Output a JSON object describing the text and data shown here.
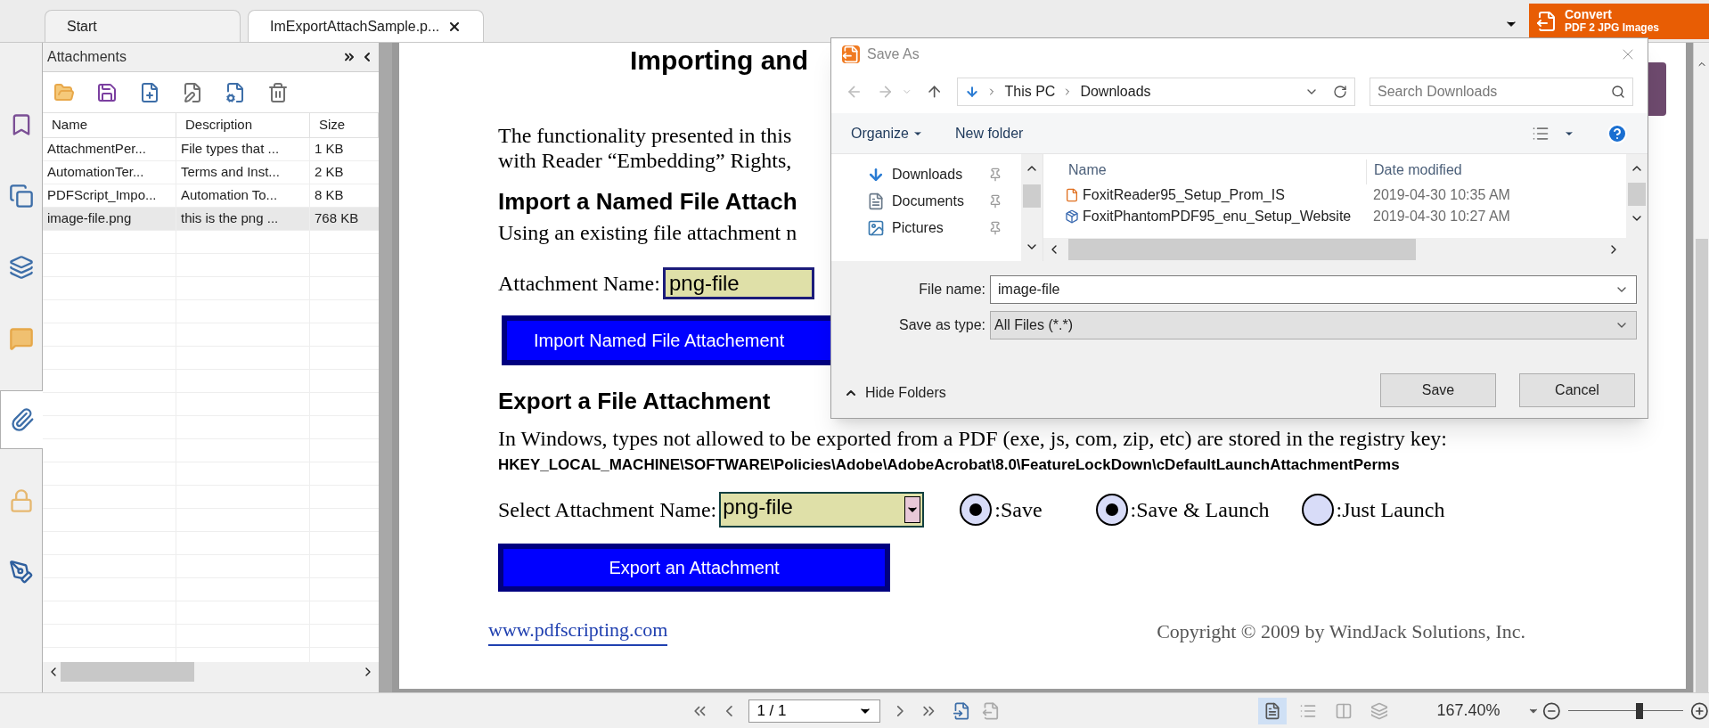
{
  "tabs": [
    {
      "label": "Start",
      "selected": false
    },
    {
      "label": "ImExportAttachSample.p...",
      "selected": true
    }
  ],
  "convert_banner": {
    "line_1": "Convert",
    "line_2": "PDF 2 JPG Images"
  },
  "left_tabs": [
    {
      "kind": "bookmarks",
      "selected": false
    },
    {
      "kind": "pages",
      "selected": false
    },
    {
      "kind": "layers",
      "selected": false
    },
    {
      "kind": "comments",
      "selected": false
    },
    {
      "kind": "attachments",
      "selected": true
    },
    {
      "kind": "security",
      "selected": false
    },
    {
      "kind": "signatures",
      "selected": false
    }
  ],
  "attachments_panel": {
    "title": "Attachments",
    "columns": [
      "Name",
      "Description",
      "Size"
    ],
    "rows": [
      {
        "name": "AttachmentPer...",
        "description": "File types that ...",
        "size": "1 KB",
        "selected": false
      },
      {
        "name": "AutomationTer...",
        "description": "Terms and Inst...",
        "size": "2 KB",
        "selected": false
      },
      {
        "name": "PDFScript_Impo...",
        "description": "Automation To...",
        "size": "8 KB",
        "selected": false
      },
      {
        "name": "image-file.png",
        "description": "this is the png ...",
        "size": "768 KB",
        "selected": true
      }
    ]
  },
  "document": {
    "title": "Importing and",
    "intro_lines": [
      "The functionality presented in this",
      "with Reader “Embedding” Rights,"
    ],
    "import_heading": "Import a Named File Attach",
    "import_text": "Using an existing file attachment n",
    "attachment_label": "Attachment Name:",
    "attachment_value": "png-file",
    "import_button": "Import Named File Attachement",
    "export_heading": "Export a File Attachment",
    "export_text": "In Windows, types not allowed to be exported from a PDF (exe, js, com, zip, etc) are stored in the registry key:",
    "registry_key": "HKEY_LOCAL_MACHINE\\SOFTWARE\\Policies\\Adobe\\AdobeAcrobat\\8.0\\FeatureLockDown\\cDefaultLaunchAttachmentPerms",
    "select_label": "Select Attachment Name:",
    "select_value": "png-file",
    "options": [
      {
        "label": ":Save",
        "checked": true
      },
      {
        "label": ":Save & Launch",
        "checked": true
      },
      {
        "label": ":Just Launch",
        "checked": false
      }
    ],
    "export_button": "Export an Attachment",
    "link": "www.pdfscripting.com",
    "copyright": "Copyright © 2009 by WindJack Solutions, Inc."
  },
  "save_dialog": {
    "title": "Save As",
    "breadcrumb": [
      "This PC",
      "Downloads"
    ],
    "search": {
      "placeholder": "Search Downloads"
    },
    "organize": "Organize",
    "new_folder": "New folder",
    "nav_items": [
      {
        "label": "Downloads",
        "kind": "downloads"
      },
      {
        "label": "Documents",
        "kind": "documents"
      },
      {
        "label": "Pictures",
        "kind": "pictures"
      }
    ],
    "columns": [
      "Name",
      "Date modified"
    ],
    "files": [
      {
        "name": "FoxitReader95_Setup_Prom_IS",
        "date": "2019-04-30 10:35 AM",
        "kind": "reader"
      },
      {
        "name": "FoxitPhantomPDF95_enu_Setup_Website",
        "date": "2019-04-30 10:27 AM",
        "kind": "installer"
      }
    ],
    "file_name": {
      "label": "File name:",
      "value": "image-file"
    },
    "save_type": {
      "label": "Save as type:",
      "value": "All Files (*.*)"
    },
    "hide_folders": "Hide Folders",
    "buttons": [
      "Save",
      "Cancel"
    ]
  },
  "page_nav": {
    "value": "1 / 1"
  },
  "view_modes": [
    {
      "kind": "single",
      "selected": true
    },
    {
      "kind": "continuous",
      "selected": false
    },
    {
      "kind": "facing",
      "selected": false
    },
    {
      "kind": "continuous_facing",
      "selected": false
    }
  ],
  "zoom": {
    "value": "167.40%",
    "level": 0.62
  }
}
